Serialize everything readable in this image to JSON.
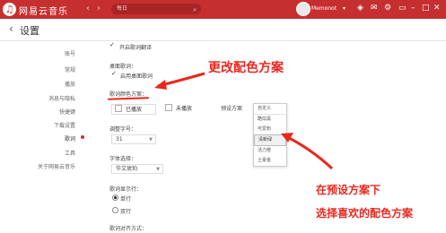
{
  "titlebar": {
    "app_name": "网易云音乐",
    "search_text": "每日",
    "username": "Memonot",
    "bg": "#c62f2f"
  },
  "header": {
    "back": "‹",
    "title": "设置"
  },
  "sidebar": {
    "items": [
      {
        "label": "账号"
      },
      {
        "label": "常规"
      },
      {
        "label": "播放"
      },
      {
        "label": "消息与隐私"
      },
      {
        "label": "快捷键"
      },
      {
        "label": "下载设置"
      },
      {
        "label": "歌词",
        "active": true
      },
      {
        "label": "工具"
      },
      {
        "label": "关于网易云音乐"
      }
    ]
  },
  "lyrics": {
    "option_top": "开启歌词翻译",
    "section_desktop": "桌面歌词：",
    "option_desktop": "启用桌面歌词",
    "section_color": "歌词颜色方案：",
    "theme_a": "已播放",
    "theme_b": "未播放",
    "preset_label": "预设方案",
    "preset_options": [
      "自定义",
      "酷炫黑",
      "可爱粉",
      "清新绿",
      "活力橙",
      "土豪金"
    ],
    "preset_selected_index": 2,
    "font_size_label": "调整字号：",
    "font_size_value": "31",
    "font_label": "字体选择：",
    "font_value": "华文琥珀",
    "layout_label": "歌词显示行：",
    "layout_options": [
      "单行",
      "双行"
    ],
    "layout_selected_index": 0,
    "align_label": "歌词对齐方式："
  },
  "annotations": {
    "top": "更改配色方案",
    "bottom_1": "在预设方案下",
    "bottom_2": "选择喜欢的配色方案",
    "color": "#e8281e"
  }
}
